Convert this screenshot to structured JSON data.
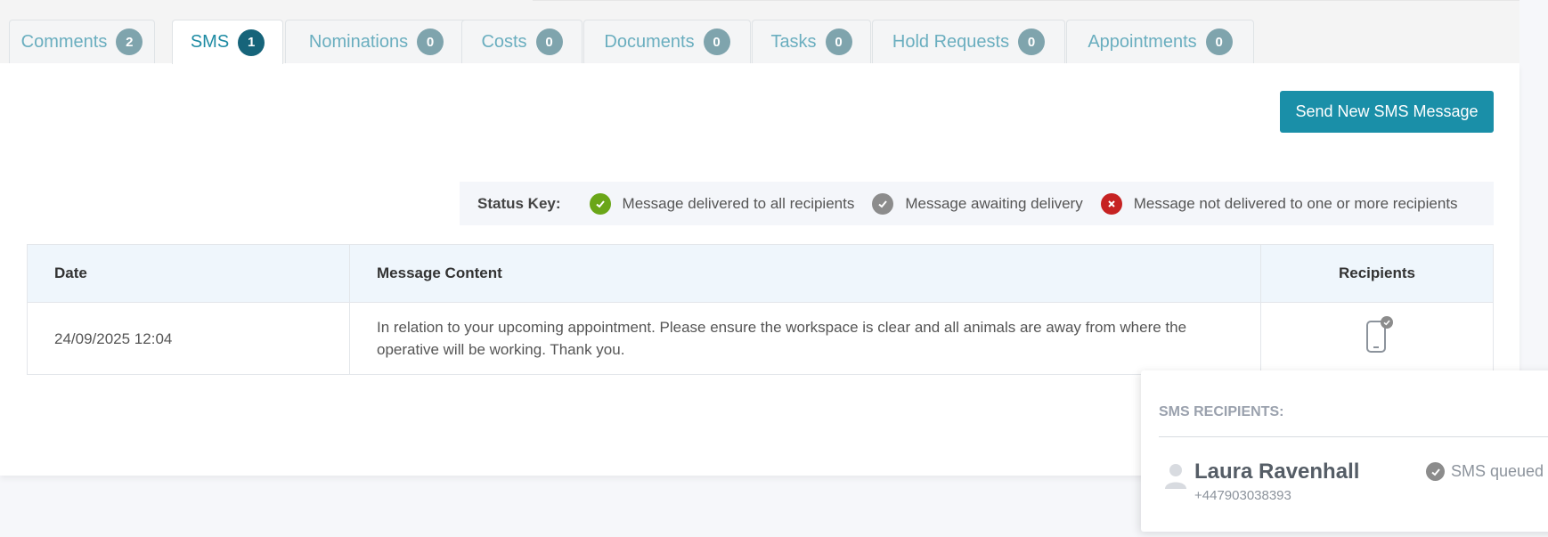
{
  "tabs": [
    {
      "label": "Comments",
      "count": "2"
    },
    {
      "label": "SMS",
      "count": "1"
    },
    {
      "label": "Nominations",
      "count": "0"
    },
    {
      "label": "Costs",
      "count": "0"
    },
    {
      "label": "Documents",
      "count": "0"
    },
    {
      "label": "Tasks",
      "count": "0"
    },
    {
      "label": "Hold Requests",
      "count": "0"
    },
    {
      "label": "Appointments",
      "count": "0"
    }
  ],
  "active_tab": "SMS",
  "send_button": "Send New SMS Message",
  "status_key": {
    "title": "Status Key:",
    "items": [
      {
        "label": "Message delivered to all recipients",
        "icon": "check-icon",
        "color": "#6aa618"
      },
      {
        "label": "Message awaiting delivery",
        "icon": "check-icon",
        "color": "#8c8c8c"
      },
      {
        "label": "Message not delivered to one or more recipients",
        "icon": "cross-icon",
        "color": "#c62222"
      }
    ]
  },
  "table": {
    "headers": [
      "Date",
      "Message Content",
      "Recipients"
    ],
    "rows": [
      {
        "date": "24/09/2025 12:04",
        "content": "In relation to your upcoming appointment. Please ensure the workspace is clear and all animals are away from where the operative will be working. Thank you.",
        "recipients_icon": "phone-icon"
      }
    ]
  },
  "popover": {
    "title": "SMS RECIPIENTS:",
    "recipient": {
      "name": "Laura Ravenhall",
      "phone": "+447903038393",
      "status": "SMS queued"
    }
  },
  "colors": {
    "accent": "#1a8fa8",
    "badge": "#7fa4ad",
    "badge_active": "#16647a",
    "table_header_bg": "#eff6fc"
  }
}
